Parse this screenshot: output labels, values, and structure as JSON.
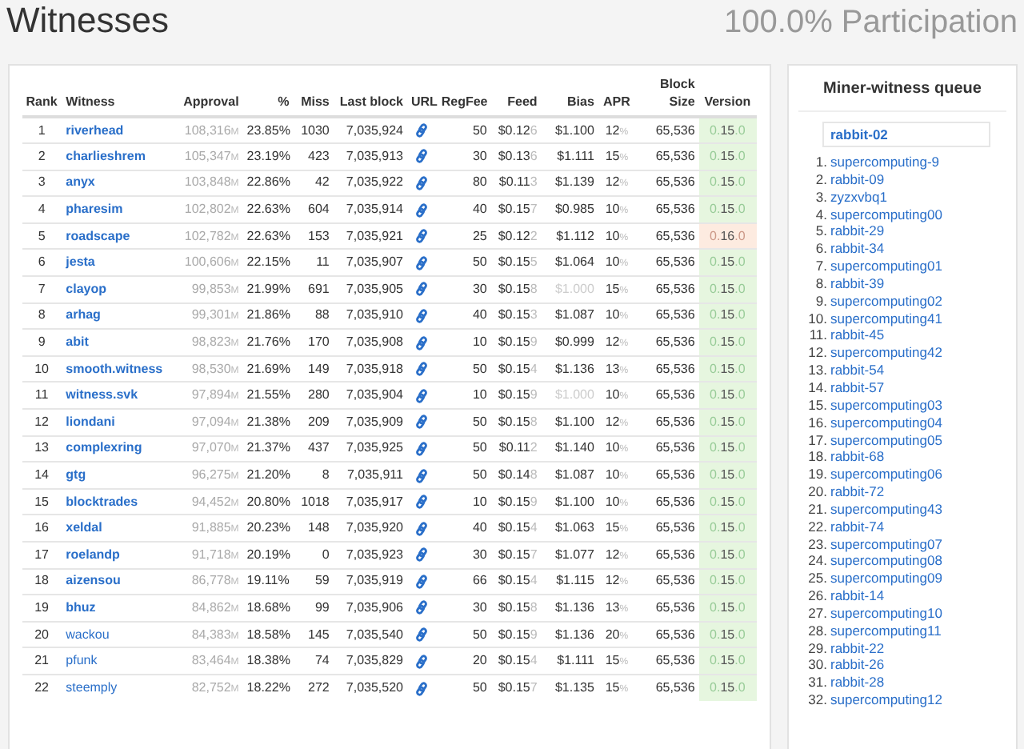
{
  "header": {
    "title": "Witnesses",
    "participation": "100.0% Participation"
  },
  "table": {
    "columns": [
      "Rank",
      "Witness",
      "Approval",
      "%",
      "Miss",
      "Last block",
      "URL",
      "RegFee",
      "Feed",
      "Bias",
      "APR",
      "Block Size",
      "Version"
    ],
    "rows": [
      {
        "rank": "1",
        "witness": "riverhead",
        "elected": true,
        "approval": "108,316",
        "approval_unit": "M",
        "percent": "23.85%",
        "miss": "1030",
        "last_block": "7,035,924",
        "regfee": "50",
        "feed": "$0.12",
        "feed_tail": "6",
        "bias": "$1.100",
        "bias_dim": false,
        "apr": "12",
        "apr_unit": "%",
        "block_size": "65,536",
        "version": "0.15.0",
        "newer": false
      },
      {
        "rank": "2",
        "witness": "charlieshrem",
        "elected": true,
        "approval": "105,347",
        "approval_unit": "M",
        "percent": "23.19%",
        "miss": "423",
        "last_block": "7,035,913",
        "regfee": "30",
        "feed": "$0.13",
        "feed_tail": "6",
        "bias": "$1.111",
        "bias_dim": false,
        "apr": "15",
        "apr_unit": "%",
        "block_size": "65,536",
        "version": "0.15.0",
        "newer": false
      },
      {
        "rank": "3",
        "witness": "anyx",
        "elected": true,
        "approval": "103,848",
        "approval_unit": "M",
        "percent": "22.86%",
        "miss": "42",
        "last_block": "7,035,922",
        "regfee": "80",
        "feed": "$0.11",
        "feed_tail": "3",
        "bias": "$1.139",
        "bias_dim": false,
        "apr": "12",
        "apr_unit": "%",
        "block_size": "65,536",
        "version": "0.15.0",
        "newer": false
      },
      {
        "rank": "4",
        "witness": "pharesim",
        "elected": true,
        "approval": "102,802",
        "approval_unit": "M",
        "percent": "22.63%",
        "miss": "604",
        "last_block": "7,035,914",
        "regfee": "40",
        "feed": "$0.15",
        "feed_tail": "7",
        "bias": "$0.985",
        "bias_dim": false,
        "apr": "10",
        "apr_unit": "%",
        "block_size": "65,536",
        "version": "0.15.0",
        "newer": false
      },
      {
        "rank": "5",
        "witness": "roadscape",
        "elected": true,
        "approval": "102,782",
        "approval_unit": "M",
        "percent": "22.63%",
        "miss": "153",
        "last_block": "7,035,921",
        "regfee": "25",
        "feed": "$0.12",
        "feed_tail": "2",
        "bias": "$1.112",
        "bias_dim": false,
        "apr": "10",
        "apr_unit": "%",
        "block_size": "65,536",
        "version": "0.16.0",
        "newer": true
      },
      {
        "rank": "6",
        "witness": "jesta",
        "elected": true,
        "approval": "100,606",
        "approval_unit": "M",
        "percent": "22.15%",
        "miss": "11",
        "last_block": "7,035,907",
        "regfee": "50",
        "feed": "$0.15",
        "feed_tail": "5",
        "bias": "$1.064",
        "bias_dim": false,
        "apr": "10",
        "apr_unit": "%",
        "block_size": "65,536",
        "version": "0.15.0",
        "newer": false
      },
      {
        "rank": "7",
        "witness": "clayop",
        "elected": true,
        "approval": "99,853",
        "approval_unit": "M",
        "percent": "21.99%",
        "miss": "691",
        "last_block": "7,035,905",
        "regfee": "30",
        "feed": "$0.15",
        "feed_tail": "8",
        "bias": "$1.000",
        "bias_dim": true,
        "apr": "15",
        "apr_unit": "%",
        "block_size": "65,536",
        "version": "0.15.0",
        "newer": false
      },
      {
        "rank": "8",
        "witness": "arhag",
        "elected": true,
        "approval": "99,301",
        "approval_unit": "M",
        "percent": "21.86%",
        "miss": "88",
        "last_block": "7,035,910",
        "regfee": "40",
        "feed": "$0.15",
        "feed_tail": "3",
        "bias": "$1.087",
        "bias_dim": false,
        "apr": "10",
        "apr_unit": "%",
        "block_size": "65,536",
        "version": "0.15.0",
        "newer": false
      },
      {
        "rank": "9",
        "witness": "abit",
        "elected": true,
        "approval": "98,823",
        "approval_unit": "M",
        "percent": "21.76%",
        "miss": "170",
        "last_block": "7,035,908",
        "regfee": "10",
        "feed": "$0.15",
        "feed_tail": "9",
        "bias": "$0.999",
        "bias_dim": false,
        "apr": "12",
        "apr_unit": "%",
        "block_size": "65,536",
        "version": "0.15.0",
        "newer": false
      },
      {
        "rank": "10",
        "witness": "smooth.witness",
        "elected": true,
        "approval": "98,530",
        "approval_unit": "M",
        "percent": "21.69%",
        "miss": "149",
        "last_block": "7,035,918",
        "regfee": "50",
        "feed": "$0.15",
        "feed_tail": "4",
        "bias": "$1.136",
        "bias_dim": false,
        "apr": "13",
        "apr_unit": "%",
        "block_size": "65,536",
        "version": "0.15.0",
        "newer": false
      },
      {
        "rank": "11",
        "witness": "witness.svk",
        "elected": true,
        "approval": "97,894",
        "approval_unit": "M",
        "percent": "21.55%",
        "miss": "280",
        "last_block": "7,035,904",
        "regfee": "10",
        "feed": "$0.15",
        "feed_tail": "9",
        "bias": "$1.000",
        "bias_dim": true,
        "apr": "10",
        "apr_unit": "%",
        "block_size": "65,536",
        "version": "0.15.0",
        "newer": false
      },
      {
        "rank": "12",
        "witness": "liondani",
        "elected": true,
        "approval": "97,094",
        "approval_unit": "M",
        "percent": "21.38%",
        "miss": "209",
        "last_block": "7,035,909",
        "regfee": "50",
        "feed": "$0.15",
        "feed_tail": "8",
        "bias": "$1.100",
        "bias_dim": false,
        "apr": "12",
        "apr_unit": "%",
        "block_size": "65,536",
        "version": "0.15.0",
        "newer": false
      },
      {
        "rank": "13",
        "witness": "complexring",
        "elected": true,
        "approval": "97,070",
        "approval_unit": "M",
        "percent": "21.37%",
        "miss": "437",
        "last_block": "7,035,925",
        "regfee": "50",
        "feed": "$0.11",
        "feed_tail": "2",
        "bias": "$1.140",
        "bias_dim": false,
        "apr": "10",
        "apr_unit": "%",
        "block_size": "65,536",
        "version": "0.15.0",
        "newer": false
      },
      {
        "rank": "14",
        "witness": "gtg",
        "elected": true,
        "approval": "96,275",
        "approval_unit": "M",
        "percent": "21.20%",
        "miss": "8",
        "last_block": "7,035,911",
        "regfee": "50",
        "feed": "$0.14",
        "feed_tail": "8",
        "bias": "$1.087",
        "bias_dim": false,
        "apr": "10",
        "apr_unit": "%",
        "block_size": "65,536",
        "version": "0.15.0",
        "newer": false
      },
      {
        "rank": "15",
        "witness": "blocktrades",
        "elected": true,
        "approval": "94,452",
        "approval_unit": "M",
        "percent": "20.80%",
        "miss": "1018",
        "last_block": "7,035,917",
        "regfee": "10",
        "feed": "$0.15",
        "feed_tail": "9",
        "bias": "$1.100",
        "bias_dim": false,
        "apr": "10",
        "apr_unit": "%",
        "block_size": "65,536",
        "version": "0.15.0",
        "newer": false
      },
      {
        "rank": "16",
        "witness": "xeldal",
        "elected": true,
        "approval": "91,885",
        "approval_unit": "M",
        "percent": "20.23%",
        "miss": "148",
        "last_block": "7,035,920",
        "regfee": "40",
        "feed": "$0.15",
        "feed_tail": "4",
        "bias": "$1.063",
        "bias_dim": false,
        "apr": "15",
        "apr_unit": "%",
        "block_size": "65,536",
        "version": "0.15.0",
        "newer": false
      },
      {
        "rank": "17",
        "witness": "roelandp",
        "elected": true,
        "approval": "91,718",
        "approval_unit": "M",
        "percent": "20.19%",
        "miss": "0",
        "last_block": "7,035,923",
        "regfee": "30",
        "feed": "$0.15",
        "feed_tail": "7",
        "bias": "$1.077",
        "bias_dim": false,
        "apr": "12",
        "apr_unit": "%",
        "block_size": "65,536",
        "version": "0.15.0",
        "newer": false
      },
      {
        "rank": "18",
        "witness": "aizensou",
        "elected": true,
        "approval": "86,778",
        "approval_unit": "M",
        "percent": "19.11%",
        "miss": "59",
        "last_block": "7,035,919",
        "regfee": "66",
        "feed": "$0.15",
        "feed_tail": "4",
        "bias": "$1.115",
        "bias_dim": false,
        "apr": "12",
        "apr_unit": "%",
        "block_size": "65,536",
        "version": "0.15.0",
        "newer": false
      },
      {
        "rank": "19",
        "witness": "bhuz",
        "elected": true,
        "approval": "84,862",
        "approval_unit": "M",
        "percent": "18.68%",
        "miss": "99",
        "last_block": "7,035,906",
        "regfee": "30",
        "feed": "$0.15",
        "feed_tail": "8",
        "bias": "$1.136",
        "bias_dim": false,
        "apr": "13",
        "apr_unit": "%",
        "block_size": "65,536",
        "version": "0.15.0",
        "newer": false
      },
      {
        "rank": "20",
        "witness": "wackou",
        "elected": false,
        "approval": "84,383",
        "approval_unit": "M",
        "percent": "18.58%",
        "miss": "145",
        "last_block": "7,035,540",
        "regfee": "50",
        "feed": "$0.15",
        "feed_tail": "9",
        "bias": "$1.136",
        "bias_dim": false,
        "apr": "20",
        "apr_unit": "%",
        "block_size": "65,536",
        "version": "0.15.0",
        "newer": false
      },
      {
        "rank": "21",
        "witness": "pfunk",
        "elected": false,
        "approval": "83,464",
        "approval_unit": "M",
        "percent": "18.38%",
        "miss": "74",
        "last_block": "7,035,829",
        "regfee": "20",
        "feed": "$0.15",
        "feed_tail": "4",
        "bias": "$1.111",
        "bias_dim": false,
        "apr": "15",
        "apr_unit": "%",
        "block_size": "65,536",
        "version": "0.15.0",
        "newer": false
      },
      {
        "rank": "22",
        "witness": "steemply",
        "elected": false,
        "approval": "82,752",
        "approval_unit": "M",
        "percent": "18.22%",
        "miss": "272",
        "last_block": "7,035,520",
        "regfee": "50",
        "feed": "$0.15",
        "feed_tail": "7",
        "bias": "$1.135",
        "bias_dim": false,
        "apr": "15",
        "apr_unit": "%",
        "block_size": "65,536",
        "version": "0.15.0",
        "newer": false
      }
    ]
  },
  "queue": {
    "title": "Miner-witness queue",
    "current": "rabbit-02",
    "items": [
      {
        "number": "1.",
        "name": "supercomputing-9"
      },
      {
        "number": "2.",
        "name": "rabbit-09"
      },
      {
        "number": "3.",
        "name": "zyzxvbq1"
      },
      {
        "number": "4.",
        "name": "supercomputing00"
      },
      {
        "number": "5.",
        "name": "rabbit-29"
      },
      {
        "number": "6.",
        "name": "rabbit-34"
      },
      {
        "number": "7.",
        "name": "supercomputing01"
      },
      {
        "number": "8.",
        "name": "rabbit-39"
      },
      {
        "number": "9.",
        "name": "supercomputing02"
      },
      {
        "number": "10.",
        "name": "supercomputing41"
      },
      {
        "number": "11.",
        "name": "rabbit-45"
      },
      {
        "number": "12.",
        "name": "supercomputing42"
      },
      {
        "number": "13.",
        "name": "rabbit-54"
      },
      {
        "number": "14.",
        "name": "rabbit-57"
      },
      {
        "number": "15.",
        "name": "supercomputing03"
      },
      {
        "number": "16.",
        "name": "supercomputing04"
      },
      {
        "number": "17.",
        "name": "supercomputing05"
      },
      {
        "number": "18.",
        "name": "rabbit-68"
      },
      {
        "number": "19.",
        "name": "supercomputing06"
      },
      {
        "number": "20.",
        "name": "rabbit-72"
      },
      {
        "number": "21.",
        "name": "supercomputing43"
      },
      {
        "number": "22.",
        "name": "rabbit-74"
      },
      {
        "number": "23.",
        "name": "supercomputing07"
      },
      {
        "number": "24.",
        "name": "supercomputing08"
      },
      {
        "number": "25.",
        "name": "supercomputing09"
      },
      {
        "number": "26.",
        "name": "rabbit-14"
      },
      {
        "number": "27.",
        "name": "supercomputing10"
      },
      {
        "number": "28.",
        "name": "supercomputing11"
      },
      {
        "number": "29.",
        "name": "rabbit-22"
      },
      {
        "number": "30.",
        "name": "rabbit-26"
      },
      {
        "number": "31.",
        "name": "rabbit-28"
      },
      {
        "number": "32.",
        "name": "supercomputing12"
      }
    ]
  }
}
